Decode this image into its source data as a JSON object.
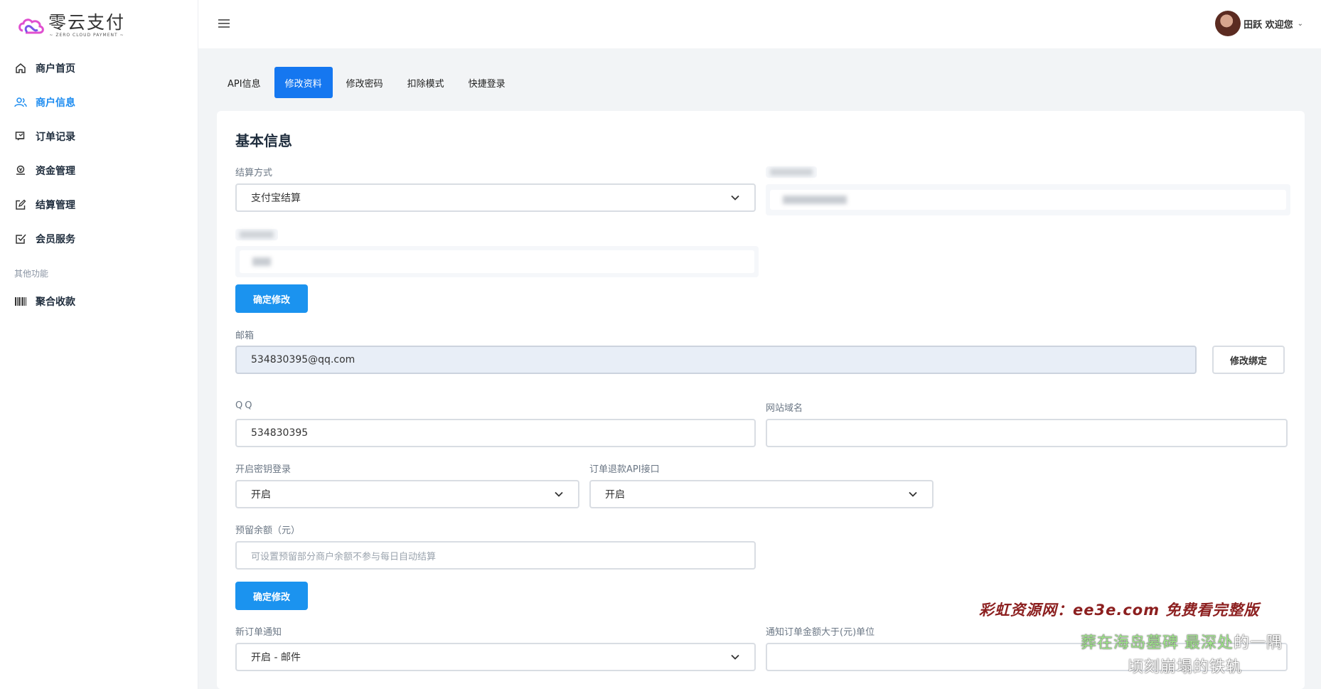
{
  "brand": {
    "title": "零云支付",
    "subtitle": "~ ZERO CLOUD PAYMENT ~"
  },
  "sidebar": {
    "items": [
      {
        "label": "商户首页",
        "icon": "home-icon"
      },
      {
        "label": "商户信息",
        "icon": "users-icon",
        "active": true
      },
      {
        "label": "订单记录",
        "icon": "receipt-icon"
      },
      {
        "label": "资金管理",
        "icon": "money-icon"
      },
      {
        "label": "结算管理",
        "icon": "edit-icon"
      },
      {
        "label": "会员服务",
        "icon": "check-square-icon"
      }
    ],
    "section_label": "其他功能",
    "extra_items": [
      {
        "label": "聚合收款",
        "icon": "barcode-icon"
      }
    ]
  },
  "topbar": {
    "user_greeting": "田跃 欢迎您"
  },
  "tabs": [
    {
      "label": "API信息"
    },
    {
      "label": "修改资料",
      "active": true
    },
    {
      "label": "修改密码"
    },
    {
      "label": "扣除模式"
    },
    {
      "label": "快捷登录"
    }
  ],
  "form": {
    "title": "基本信息",
    "settle_method": {
      "label": "结算方式",
      "value": "支付宝结算"
    },
    "confirm_label": "确定修改",
    "email": {
      "label": "邮箱",
      "value": "534830395@qq.com",
      "action": "修改绑定"
    },
    "qq": {
      "label": "QQ",
      "value": "534830395"
    },
    "site_domain": {
      "label": "网站域名",
      "value": ""
    },
    "key_login": {
      "label": "开启密钥登录",
      "value": "开启"
    },
    "refund_api": {
      "label": "订单退款API接口",
      "value": "开启"
    },
    "reserve_balance": {
      "label": "预留余额（元）",
      "placeholder": "可设置预留部分商户余额不参与每日自动结算"
    },
    "new_order_notice": {
      "label": "新订单通知",
      "value": "开启 - 邮件"
    },
    "notice_amount": {
      "label": "通知订单金额大于(元)单位",
      "value": ""
    }
  },
  "watermark": {
    "line1": "彩虹资源网：ee3e.com 免费看完整版",
    "line2_highlight": "葬在海岛墓碑 最深处",
    "line2_rest": "的一隅",
    "line3": "顷刻崩塌的铁轨"
  },
  "colors": {
    "accent": "#1577f0",
    "button": "#1b93ef",
    "active_nav": "#1b8bf0"
  }
}
